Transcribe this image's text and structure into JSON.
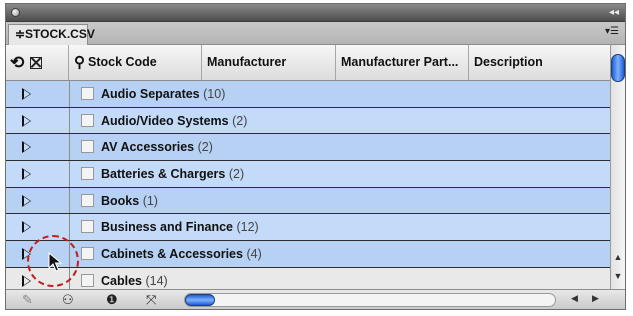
{
  "window": {
    "collapse_glyph": "◂◂",
    "tab_title": "≑STOCK.CSV",
    "panel_menu_glyph": "▾☰"
  },
  "header": {
    "sync_glyph": "⟲",
    "columns": [
      {
        "label": "Stock Code"
      },
      {
        "label": "Manufacturer"
      },
      {
        "label": "Manufacturer Part..."
      },
      {
        "label": "Description"
      }
    ]
  },
  "rows": [
    {
      "name": "Audio Separates",
      "count": "(10)"
    },
    {
      "name": "Audio/Video Systems",
      "count": "(2)"
    },
    {
      "name": "AV Accessories",
      "count": "(2)"
    },
    {
      "name": "Batteries & Chargers",
      "count": "(2)"
    },
    {
      "name": "Books",
      "count": "(1)"
    },
    {
      "name": "Business and Finance",
      "count": "(12)"
    },
    {
      "name": "Cabinets & Accessories",
      "count": "(4)"
    },
    {
      "name": "Cables",
      "count": "(14)"
    }
  ],
  "footer": {
    "icons": [
      "pencil-icon",
      "binoculars-icon",
      "info-icon",
      "shrink-icon"
    ],
    "glyphs": {
      "pencil": "✎",
      "binoculars": "⚇",
      "info": "❶",
      "shrink": "⤧"
    },
    "left_arrow": "◀",
    "right_arrow": "▶"
  },
  "scroll": {
    "up_arrow": "▲",
    "down_arrow": "▼"
  },
  "colors": {
    "selected_row": "#b7d1f4",
    "scroll_accent": "#1b5fd0",
    "annotation": "#c21d1d"
  }
}
